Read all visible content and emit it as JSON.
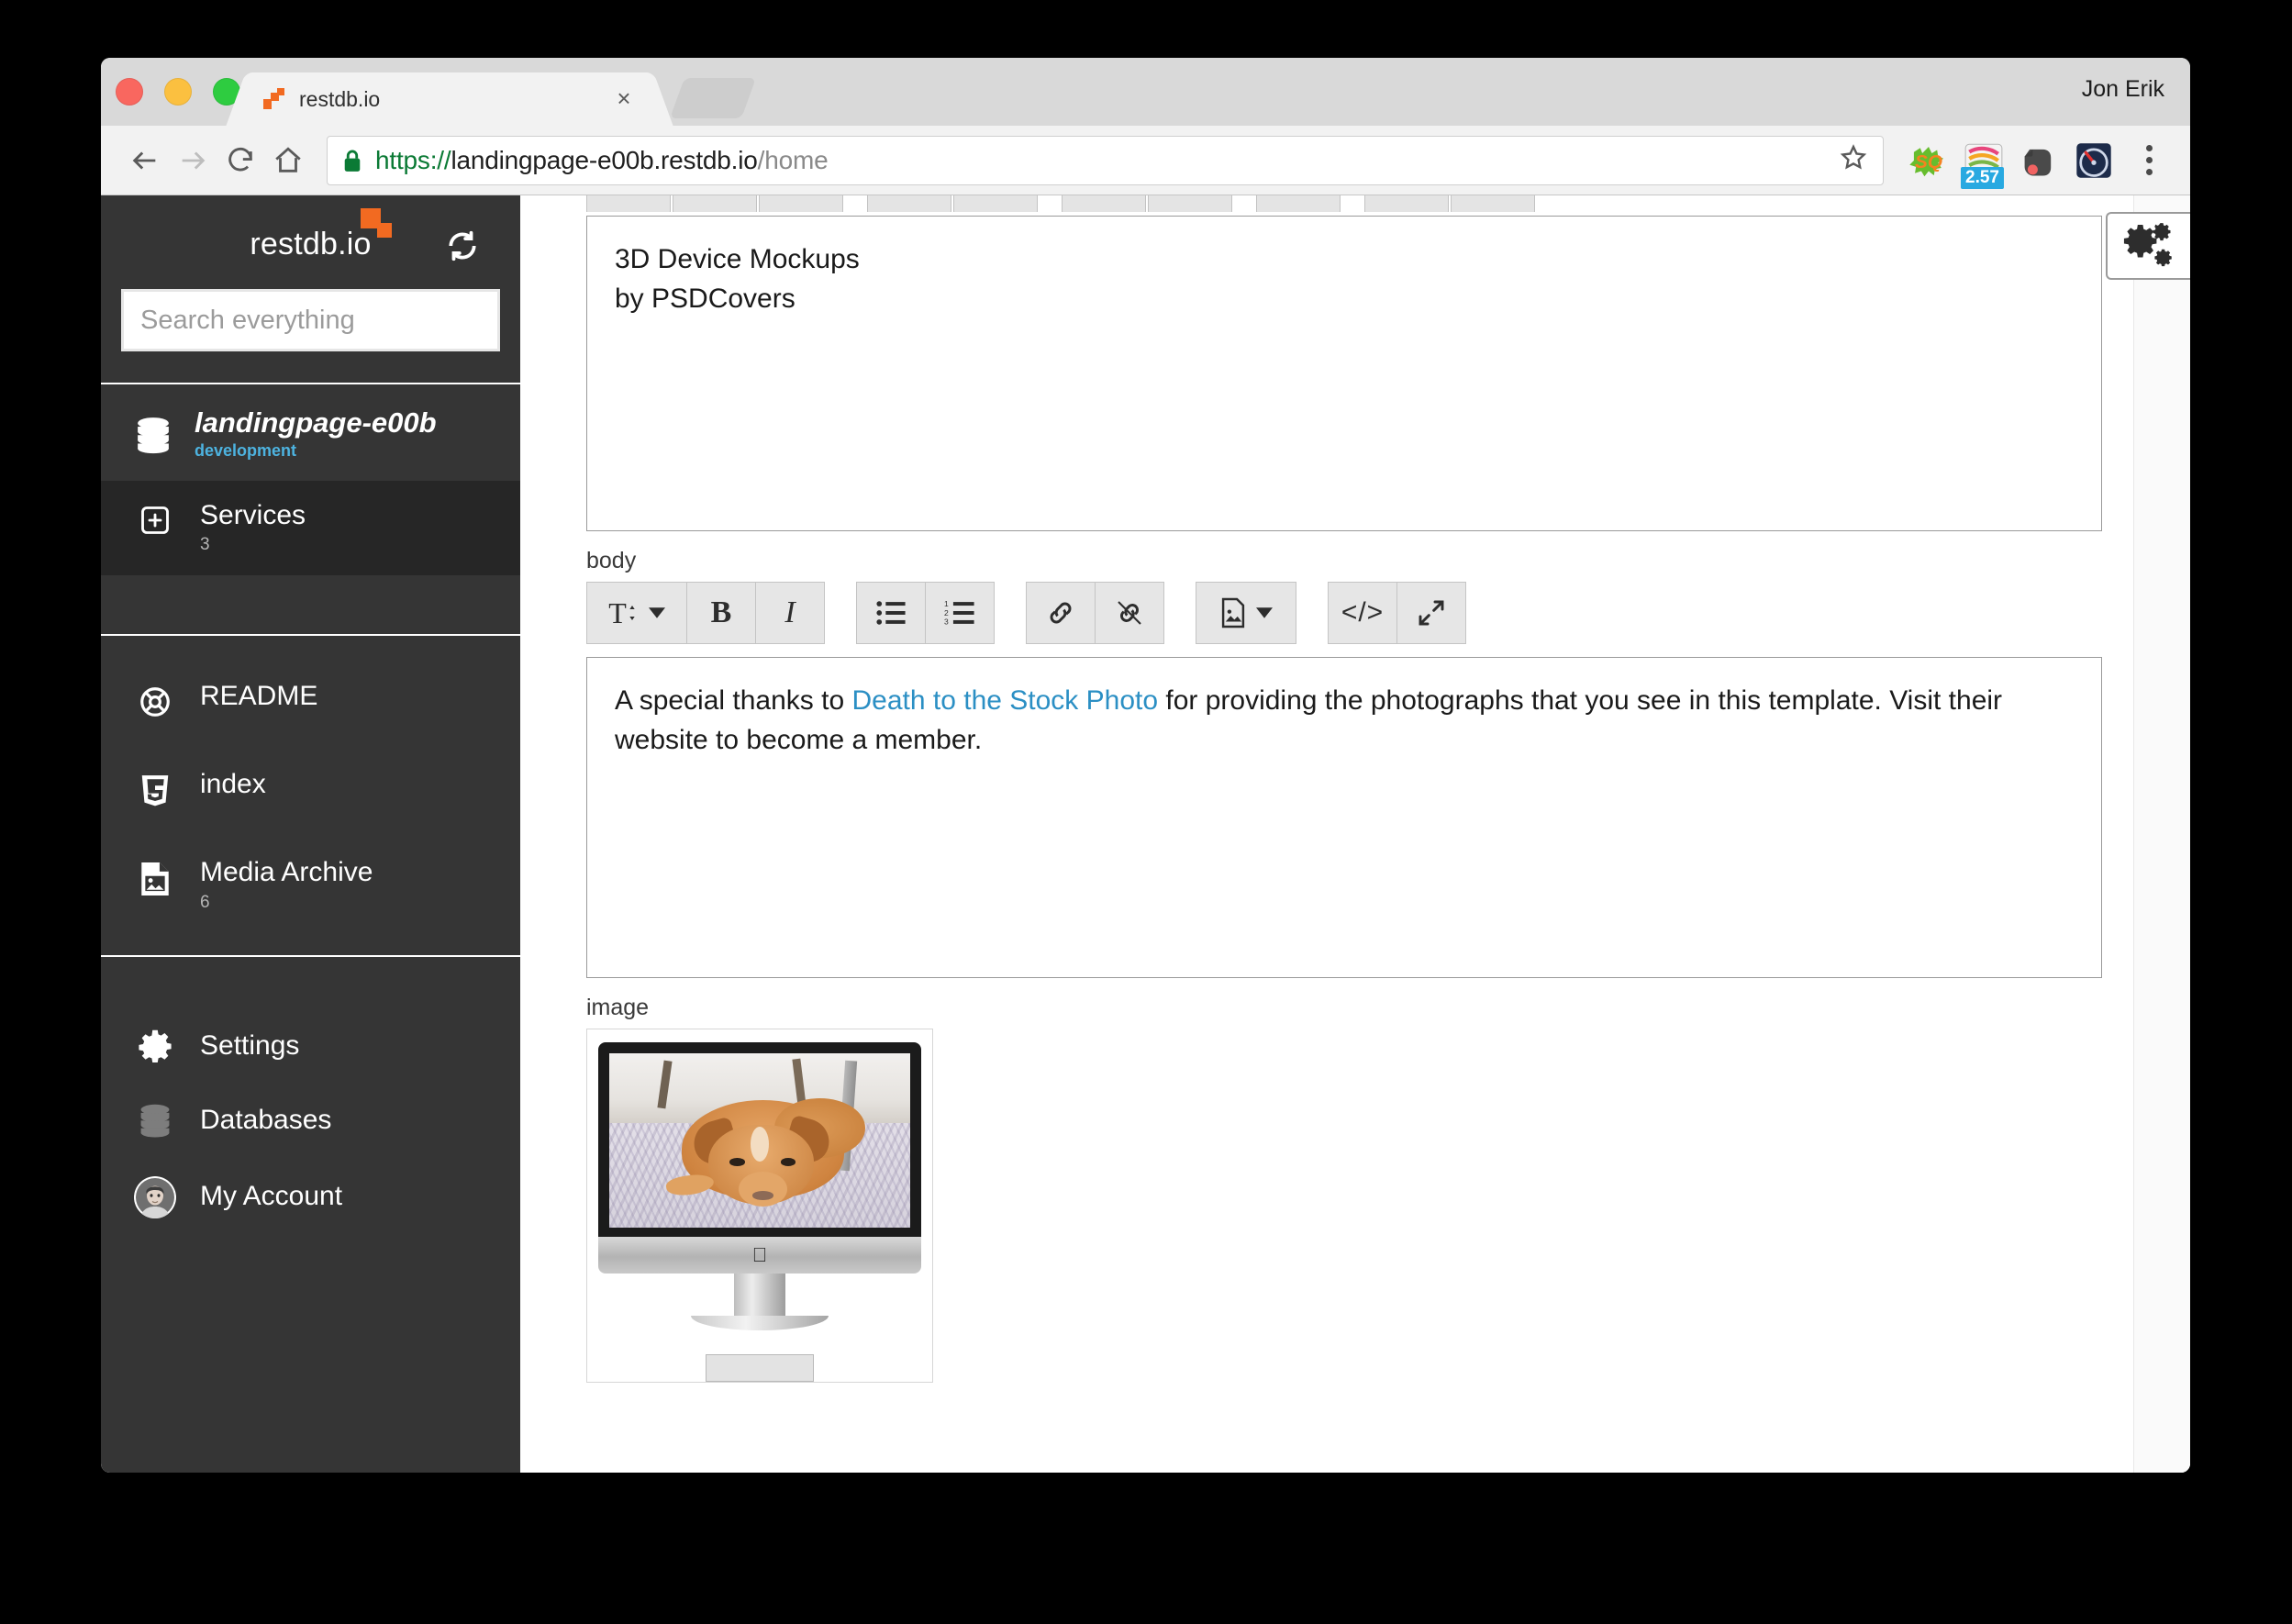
{
  "browser": {
    "profile_name": "Jon Erik",
    "tab": {
      "title": "restdb.io",
      "favicon": "restdb-logo-icon",
      "close": "×"
    },
    "newtab_label": "",
    "nav": {
      "back": "back-icon",
      "forward": "forward-icon",
      "reload": "reload-icon",
      "home": "home-icon"
    },
    "url": {
      "scheme": "https://",
      "host": "landingpage-e00b.restdb.io",
      "path": "/home",
      "secure": true
    },
    "extensions": [
      {
        "name": "sq-extension-icon",
        "badge": null
      },
      {
        "name": "colorzilla-extension-icon",
        "badge": "2.57"
      },
      {
        "name": "evernote-extension-icon",
        "badge": null
      },
      {
        "name": "speedometer-extension-icon",
        "badge": null
      }
    ],
    "bookmark_star": "star-icon",
    "menu": "kebab-menu-icon"
  },
  "sidebar": {
    "logo_text": "restdb.io",
    "refresh_icon": "refresh-icon",
    "search": {
      "placeholder": "Search everything",
      "value": ""
    },
    "database": {
      "name": "landingpage-e00b",
      "environment": "development",
      "icon": "database-stack-icon"
    },
    "collections": [
      {
        "label": "Services",
        "count": "3",
        "icon": "plus-box-icon",
        "active": true
      }
    ],
    "documents": [
      {
        "label": "README",
        "count": "",
        "icon": "lifebuoy-icon"
      },
      {
        "label": "index",
        "count": "",
        "icon": "html5-shield-icon"
      },
      {
        "label": "Media Archive",
        "count": "6",
        "icon": "image-file-icon"
      }
    ],
    "footer": [
      {
        "label": "Settings",
        "icon": "gear-icon"
      },
      {
        "label": "Databases",
        "icon": "database-stack-icon"
      },
      {
        "label": "My Account",
        "icon": "avatar-icon"
      }
    ]
  },
  "main": {
    "settings_fab": "gears-icon",
    "fields": [
      {
        "label": "",
        "type": "textarea",
        "value": "3D Device Mockups\nby PSDCovers"
      },
      {
        "label": "body",
        "type": "richtext",
        "toolbar": [
          {
            "group": 0,
            "name": "text-size-button",
            "glyph": "T",
            "caret": true
          },
          {
            "group": 0,
            "name": "bold-button",
            "glyph": "B"
          },
          {
            "group": 0,
            "name": "italic-button",
            "glyph": "I"
          },
          {
            "group": 1,
            "name": "bullet-list-button",
            "glyph": "bullet-list-icon"
          },
          {
            "group": 1,
            "name": "numbered-list-button",
            "glyph": "numbered-list-icon"
          },
          {
            "group": 2,
            "name": "link-button",
            "glyph": "link-icon"
          },
          {
            "group": 2,
            "name": "unlink-button",
            "glyph": "unlink-icon"
          },
          {
            "group": 3,
            "name": "insert-image-button",
            "glyph": "image-icon",
            "caret": true
          },
          {
            "group": 4,
            "name": "code-view-button",
            "glyph": "</>"
          },
          {
            "group": 4,
            "name": "fullscreen-button",
            "glyph": "expand-arrows-icon"
          }
        ],
        "content": {
          "before": "A special thanks to ",
          "link": "Death to the Stock Photo",
          "after": " for providing the photographs that you see in this template. Visit their website to become a member."
        }
      },
      {
        "label": "image",
        "type": "image",
        "thumbnail_alt": "iMac mockup with photo of a golden dog lying on a patterned carpet"
      }
    ]
  },
  "colors": {
    "sidebar_bg": "#353535",
    "sidebar_active": "#262626",
    "brand_orange": "#f26a21",
    "env_blue": "#4db3e0",
    "link_blue": "#2b8fc4",
    "badge_blue": "#29a9e1",
    "url_green": "#0b7a35"
  }
}
